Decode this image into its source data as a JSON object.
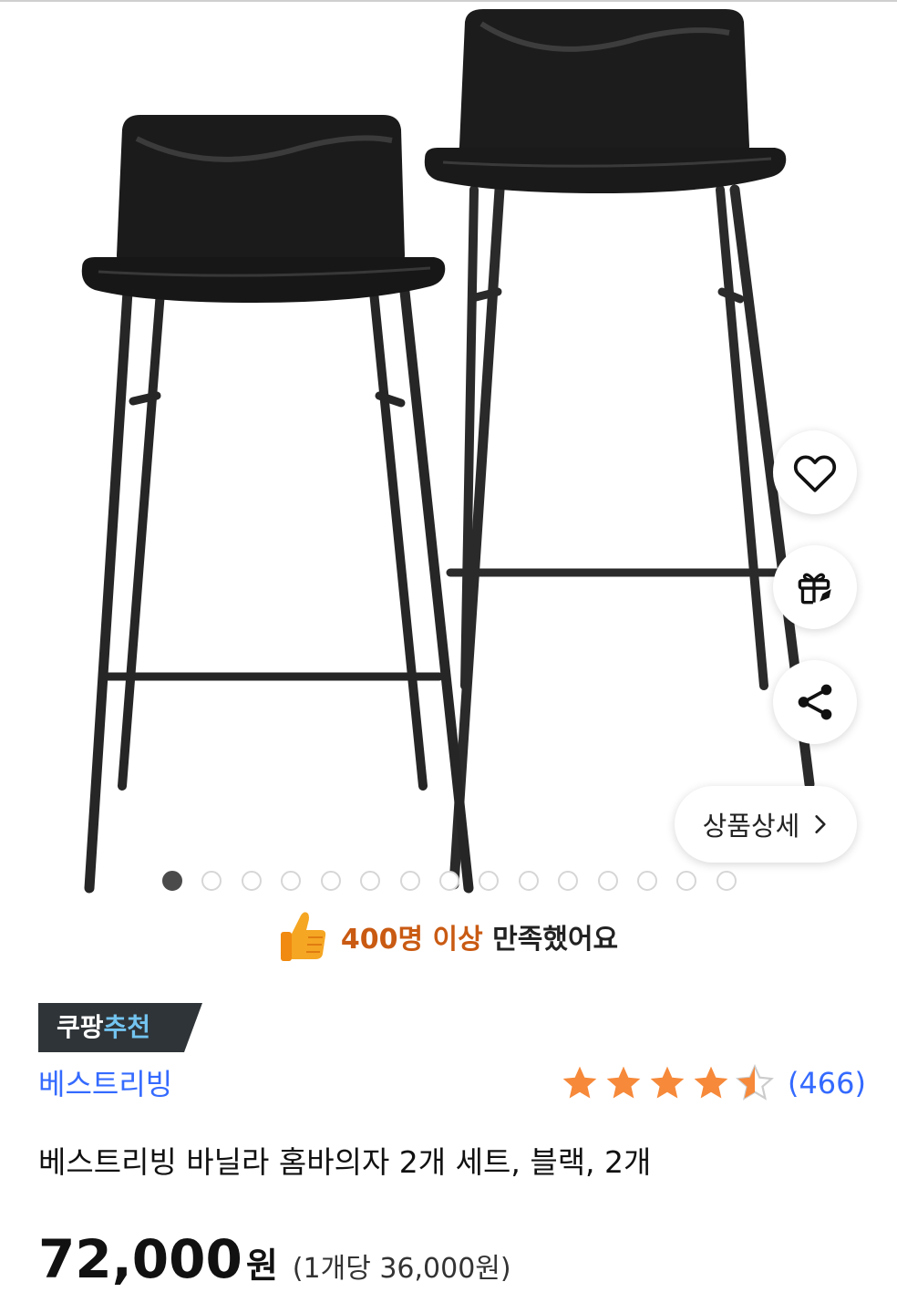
{
  "product": {
    "satisfaction_strong": "400명 이상",
    "satisfaction_rest": "만족했어요",
    "badge_prefix": "쿠팡",
    "badge_accent": "추천",
    "brand": "베스트리빙",
    "rating": 4.5,
    "review_count": "(466)",
    "title": "베스트리빙 바닐라 홈바의자 2개 세트, 블랙, 2개",
    "price": "72,000",
    "price_unit": "원",
    "unit_price": "(1개당 36,000원)",
    "detail_button": "상품상세"
  },
  "gallery": {
    "total_images": 15,
    "current_index": 1
  },
  "icons": {
    "wishlist": "heart-icon",
    "gift": "gift-icon",
    "share": "share-icon",
    "detail_arrow": "chevron-right-icon",
    "satisfaction": "thumbs-up-icon",
    "rating": "star-icon"
  },
  "colors": {
    "brand_link": "#346aff",
    "highlight": "#c95a12",
    "badge_bg": "#2f3438",
    "badge_accent": "#73c4f0",
    "star": "#f6893a",
    "dot_active": "#4b4b4b"
  }
}
